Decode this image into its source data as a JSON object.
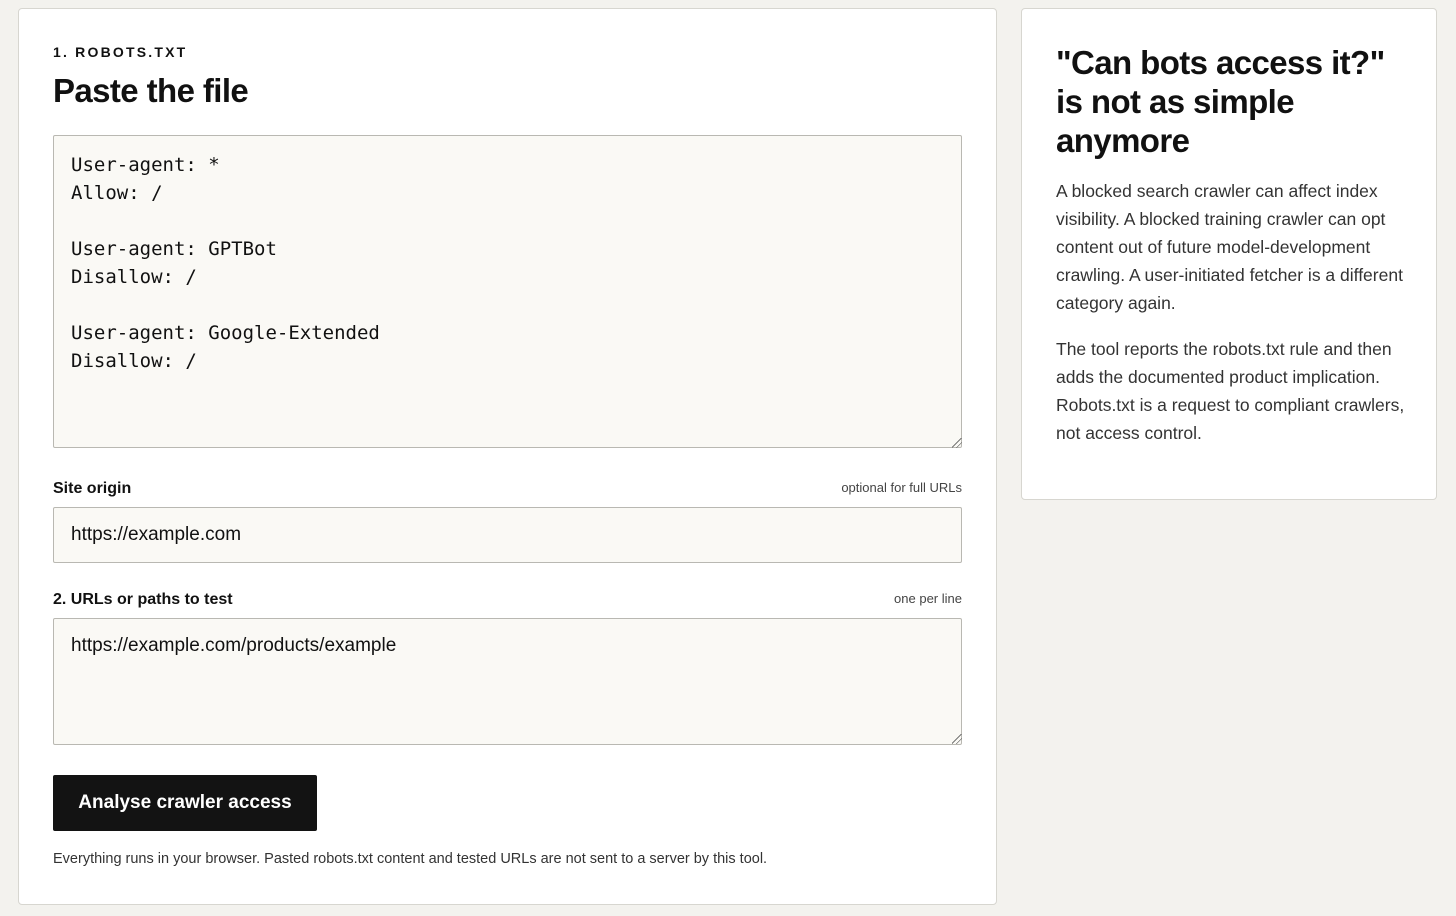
{
  "form": {
    "eyebrow": "1. ROBOTS.TXT",
    "heading": "Paste the file",
    "robots_text": "User-agent: *\nAllow: /\n\nUser-agent: GPTBot\nDisallow: /\n\nUser-agent: Google-Extended\nDisallow: /",
    "origin": {
      "label": "Site origin",
      "hint": "optional for full URLs",
      "value": "https://example.com"
    },
    "urls": {
      "label": "2. URLs or paths to test",
      "hint": "one per line",
      "value": "https://example.com/products/example"
    },
    "submit_label": "Analyse crawler access",
    "privacy_note": "Everything runs in your browser. Pasted robots.txt content and tested URLs are not sent to a server by this tool."
  },
  "sidebar": {
    "title": "\"Can bots access it?\" is not as simple anymore",
    "paragraphs": [
      "A blocked search crawler can affect index visibility. A blocked training crawler can opt content out of future model-development crawling. A user-initiated fetcher is a different category again.",
      "The tool reports the robots.txt rule and then adds the documented product implication. Robots.txt is a request to compliant crawlers, not access control."
    ]
  }
}
